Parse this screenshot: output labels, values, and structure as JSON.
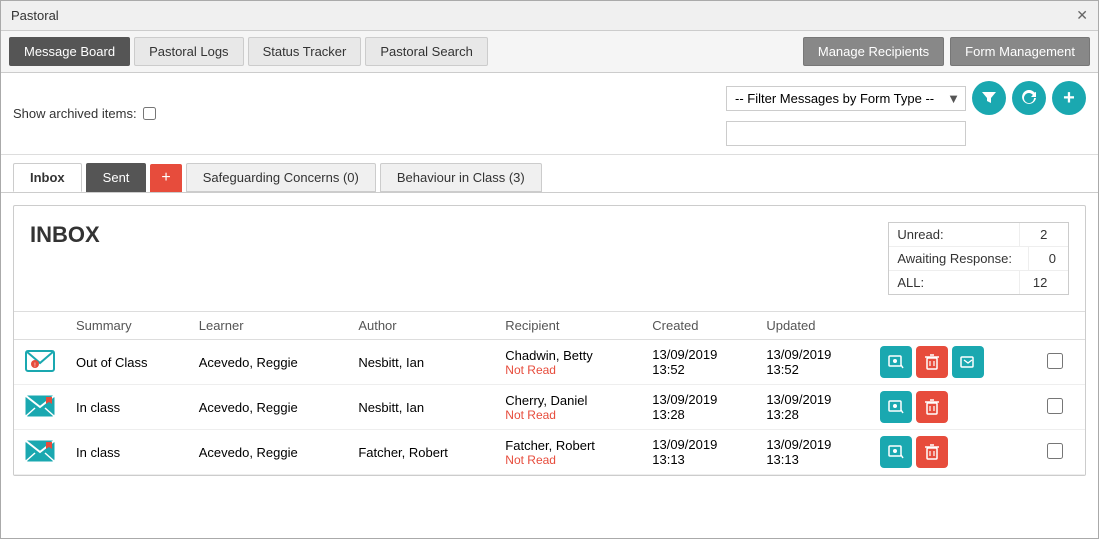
{
  "window": {
    "title": "Pastoral",
    "close_label": "✕"
  },
  "nav": {
    "tabs": [
      {
        "label": "Message Board",
        "active": true
      },
      {
        "label": "Pastoral Logs",
        "active": false
      },
      {
        "label": "Status Tracker",
        "active": false
      },
      {
        "label": "Pastoral Search",
        "active": false
      }
    ],
    "right_buttons": [
      {
        "label": "Manage Recipients"
      },
      {
        "label": "Form Management"
      }
    ]
  },
  "toolbar": {
    "show_archived_label": "Show archived items:",
    "filter_placeholder": "-- Filter Messages by Form Type --",
    "filter_search_placeholder": "",
    "filter_icon": "▼"
  },
  "sub_tabs": [
    {
      "label": "Inbox",
      "active": true,
      "type": "inbox"
    },
    {
      "label": "Sent",
      "active": false,
      "type": "sent"
    },
    {
      "label": "+",
      "active": false,
      "type": "add"
    },
    {
      "label": "Safeguarding Concerns  (0)",
      "active": false,
      "type": "normal"
    },
    {
      "label": "Behaviour in Class  (3)",
      "active": false,
      "type": "normal"
    }
  ],
  "inbox": {
    "title": "INBOX",
    "stats": [
      {
        "label": "Unread:",
        "value": "2"
      },
      {
        "label": "Awaiting Response:",
        "value": "0"
      },
      {
        "label": "ALL:",
        "value": "12"
      }
    ],
    "columns": [
      "Summary",
      "Learner",
      "Author",
      "Recipient",
      "Created",
      "Updated",
      "",
      ""
    ],
    "rows": [
      {
        "icon_type": "email-open",
        "summary": "Out of Class",
        "learner": "Acevedo, Reggie",
        "author": "Nesbitt, Ian",
        "recipient_name": "Chadwin, Betty",
        "recipient_status": "Not Read",
        "created": "13/09/2019\n13:52",
        "updated": "13/09/2019\n13:52"
      },
      {
        "icon_type": "email-flag",
        "summary": "In class",
        "learner": "Acevedo, Reggie",
        "author": "Nesbitt, Ian",
        "recipient_name": "Cherry, Daniel",
        "recipient_status": "Not Read",
        "created": "13/09/2019\n13:28",
        "updated": "13/09/2019\n13:28"
      },
      {
        "icon_type": "email-flag",
        "summary": "In class",
        "learner": "Acevedo, Reggie",
        "author": "Fatcher, Robert",
        "recipient_name": "Fatcher, Robert",
        "recipient_status": "Not Read",
        "created": "13/09/2019\n13:13",
        "updated": "13/09/2019\n13:13"
      }
    ]
  }
}
